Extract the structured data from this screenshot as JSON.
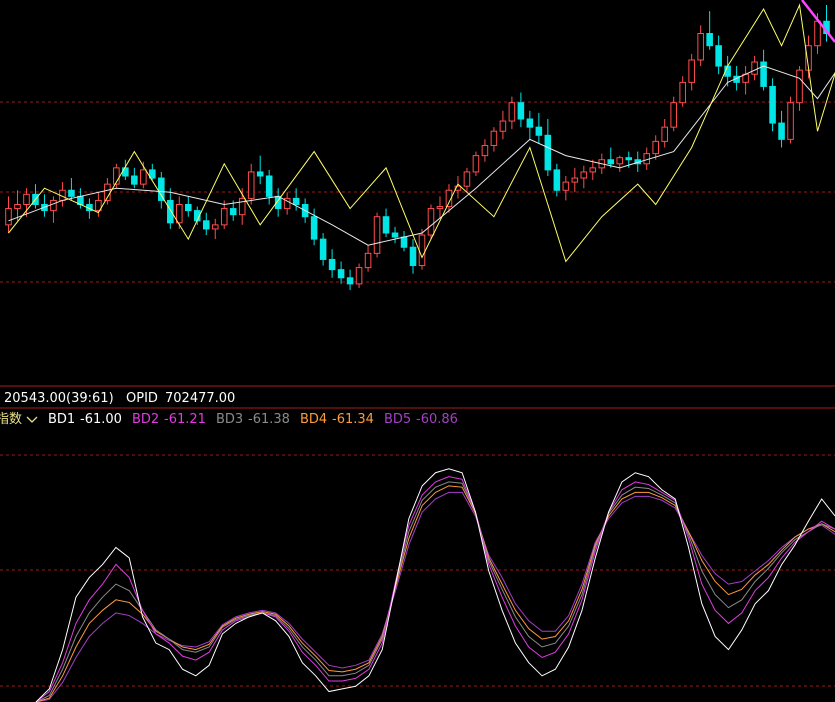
{
  "info_bar": {
    "value": "20543.00(39:61)",
    "opid_label": "OPID",
    "opid_value": "702477.00"
  },
  "indicator": {
    "name": "指数",
    "dropdown_icon": "chevron-down-icon",
    "items": [
      {
        "label": "BD1",
        "value": "-61.00",
        "color": "#ffffff"
      },
      {
        "label": "BD2",
        "value": "-61.21",
        "color": "#e03ce0"
      },
      {
        "label": "BD3",
        "value": "-61.38",
        "color": "#8a8a8a"
      },
      {
        "label": "BD4",
        "value": "-61.34",
        "color": "#ff9a3c"
      },
      {
        "label": "BD5",
        "value": "-60.86",
        "color": "#a53fc8"
      }
    ]
  },
  "colors": {
    "background": "#000000",
    "up_candle": "#ff4d4d",
    "down_candle": "#00e5e5",
    "zigzag": "#ffff66",
    "moving_average": "#e8e8e8",
    "grid": "#9a1a1a",
    "separator": "#a81c1c",
    "name_text": "#e8e08a",
    "trend_line": "#ff44ff"
  },
  "chart_data": [
    {
      "type": "candlestick",
      "title": "",
      "note": "price axis not printed; values in relative price units",
      "ylim": [
        0,
        100
      ],
      "grid": true,
      "candles": [
        {
          "o": 62,
          "h": 76,
          "l": 58,
          "c": 70
        },
        {
          "o": 70,
          "h": 79,
          "l": 64,
          "c": 72
        },
        {
          "o": 72,
          "h": 80,
          "l": 66,
          "c": 77
        },
        {
          "o": 77,
          "h": 82,
          "l": 70,
          "c": 72
        },
        {
          "o": 72,
          "h": 77,
          "l": 66,
          "c": 69
        },
        {
          "o": 69,
          "h": 76,
          "l": 63,
          "c": 74
        },
        {
          "o": 74,
          "h": 83,
          "l": 71,
          "c": 79
        },
        {
          "o": 79,
          "h": 85,
          "l": 74,
          "c": 76
        },
        {
          "o": 76,
          "h": 80,
          "l": 70,
          "c": 72
        },
        {
          "o": 72,
          "h": 75,
          "l": 65,
          "c": 69
        },
        {
          "o": 69,
          "h": 78,
          "l": 66,
          "c": 74
        },
        {
          "o": 74,
          "h": 85,
          "l": 72,
          "c": 82
        },
        {
          "o": 82,
          "h": 92,
          "l": 80,
          "c": 90
        },
        {
          "o": 90,
          "h": 94,
          "l": 84,
          "c": 86
        },
        {
          "o": 86,
          "h": 90,
          "l": 80,
          "c": 82
        },
        {
          "o": 82,
          "h": 93,
          "l": 80,
          "c": 89
        },
        {
          "o": 89,
          "h": 92,
          "l": 84,
          "c": 85
        },
        {
          "o": 85,
          "h": 88,
          "l": 70,
          "c": 74
        },
        {
          "o": 74,
          "h": 80,
          "l": 60,
          "c": 63
        },
        {
          "o": 63,
          "h": 76,
          "l": 60,
          "c": 72
        },
        {
          "o": 72,
          "h": 76,
          "l": 66,
          "c": 69
        },
        {
          "o": 69,
          "h": 71,
          "l": 62,
          "c": 64
        },
        {
          "o": 64,
          "h": 68,
          "l": 57,
          "c": 60
        },
        {
          "o": 60,
          "h": 65,
          "l": 55,
          "c": 62
        },
        {
          "o": 62,
          "h": 74,
          "l": 60,
          "c": 70
        },
        {
          "o": 70,
          "h": 74,
          "l": 64,
          "c": 67
        },
        {
          "o": 67,
          "h": 80,
          "l": 62,
          "c": 75
        },
        {
          "o": 75,
          "h": 92,
          "l": 72,
          "c": 88
        },
        {
          "o": 88,
          "h": 96,
          "l": 82,
          "c": 86
        },
        {
          "o": 86,
          "h": 89,
          "l": 72,
          "c": 76
        },
        {
          "o": 76,
          "h": 80,
          "l": 66,
          "c": 70
        },
        {
          "o": 70,
          "h": 78,
          "l": 67,
          "c": 75
        },
        {
          "o": 75,
          "h": 80,
          "l": 69,
          "c": 72
        },
        {
          "o": 72,
          "h": 75,
          "l": 63,
          "c": 66
        },
        {
          "o": 66,
          "h": 70,
          "l": 52,
          "c": 55
        },
        {
          "o": 55,
          "h": 58,
          "l": 42,
          "c": 45
        },
        {
          "o": 45,
          "h": 50,
          "l": 36,
          "c": 40
        },
        {
          "o": 40,
          "h": 44,
          "l": 33,
          "c": 36
        },
        {
          "o": 36,
          "h": 40,
          "l": 30,
          "c": 33
        },
        {
          "o": 33,
          "h": 43,
          "l": 31,
          "c": 41
        },
        {
          "o": 41,
          "h": 52,
          "l": 39,
          "c": 48
        },
        {
          "o": 48,
          "h": 68,
          "l": 46,
          "c": 66
        },
        {
          "o": 66,
          "h": 70,
          "l": 56,
          "c": 58
        },
        {
          "o": 58,
          "h": 61,
          "l": 53,
          "c": 56
        },
        {
          "o": 56,
          "h": 59,
          "l": 49,
          "c": 51
        },
        {
          "o": 51,
          "h": 55,
          "l": 38,
          "c": 42
        },
        {
          "o": 42,
          "h": 60,
          "l": 40,
          "c": 57
        },
        {
          "o": 57,
          "h": 72,
          "l": 55,
          "c": 70
        },
        {
          "o": 70,
          "h": 76,
          "l": 65,
          "c": 71
        },
        {
          "o": 71,
          "h": 82,
          "l": 68,
          "c": 79
        },
        {
          "o": 79,
          "h": 86,
          "l": 75,
          "c": 81
        },
        {
          "o": 81,
          "h": 90,
          "l": 78,
          "c": 88
        },
        {
          "o": 88,
          "h": 98,
          "l": 86,
          "c": 96
        },
        {
          "o": 96,
          "h": 104,
          "l": 93,
          "c": 101
        },
        {
          "o": 101,
          "h": 110,
          "l": 98,
          "c": 108
        },
        {
          "o": 108,
          "h": 118,
          "l": 104,
          "c": 113
        },
        {
          "o": 113,
          "h": 125,
          "l": 109,
          "c": 122
        },
        {
          "o": 122,
          "h": 127,
          "l": 110,
          "c": 114
        },
        {
          "o": 114,
          "h": 118,
          "l": 104,
          "c": 110
        },
        {
          "o": 110,
          "h": 117,
          "l": 102,
          "c": 106
        },
        {
          "o": 106,
          "h": 114,
          "l": 86,
          "c": 89
        },
        {
          "o": 89,
          "h": 92,
          "l": 76,
          "c": 79
        },
        {
          "o": 79,
          "h": 86,
          "l": 74,
          "c": 83
        },
        {
          "o": 83,
          "h": 90,
          "l": 78,
          "c": 85
        },
        {
          "o": 85,
          "h": 91,
          "l": 80,
          "c": 88
        },
        {
          "o": 88,
          "h": 94,
          "l": 84,
          "c": 90
        },
        {
          "o": 90,
          "h": 97,
          "l": 87,
          "c": 94
        },
        {
          "o": 94,
          "h": 100,
          "l": 90,
          "c": 92
        },
        {
          "o": 92,
          "h": 96,
          "l": 88,
          "c": 95
        },
        {
          "o": 95,
          "h": 98,
          "l": 90,
          "c": 94
        },
        {
          "o": 94,
          "h": 98,
          "l": 88,
          "c": 92
        },
        {
          "o": 92,
          "h": 100,
          "l": 89,
          "c": 97
        },
        {
          "o": 97,
          "h": 106,
          "l": 94,
          "c": 103
        },
        {
          "o": 103,
          "h": 114,
          "l": 100,
          "c": 110
        },
        {
          "o": 110,
          "h": 125,
          "l": 108,
          "c": 122
        },
        {
          "o": 122,
          "h": 135,
          "l": 120,
          "c": 132
        },
        {
          "o": 132,
          "h": 146,
          "l": 128,
          "c": 143
        },
        {
          "o": 143,
          "h": 160,
          "l": 140,
          "c": 156
        },
        {
          "o": 156,
          "h": 167,
          "l": 148,
          "c": 150
        },
        {
          "o": 150,
          "h": 155,
          "l": 136,
          "c": 140
        },
        {
          "o": 140,
          "h": 145,
          "l": 130,
          "c": 135
        },
        {
          "o": 135,
          "h": 140,
          "l": 128,
          "c": 132
        },
        {
          "o": 132,
          "h": 140,
          "l": 126,
          "c": 136
        },
        {
          "o": 136,
          "h": 145,
          "l": 133,
          "c": 142
        },
        {
          "o": 142,
          "h": 148,
          "l": 128,
          "c": 130
        },
        {
          "o": 130,
          "h": 134,
          "l": 108,
          "c": 112
        },
        {
          "o": 112,
          "h": 118,
          "l": 100,
          "c": 104
        },
        {
          "o": 104,
          "h": 125,
          "l": 102,
          "c": 122
        },
        {
          "o": 122,
          "h": 140,
          "l": 118,
          "c": 138
        },
        {
          "o": 138,
          "h": 155,
          "l": 134,
          "c": 150
        },
        {
          "o": 150,
          "h": 166,
          "l": 146,
          "c": 162
        },
        {
          "o": 162,
          "h": 170,
          "l": 152,
          "c": 156
        }
      ],
      "zigzag": [
        [
          0,
          58
        ],
        [
          4,
          80
        ],
        [
          10,
          68
        ],
        [
          14,
          98
        ],
        [
          20,
          55
        ],
        [
          24,
          92
        ],
        [
          28,
          62
        ],
        [
          34,
          98
        ],
        [
          38,
          70
        ],
        [
          42,
          90
        ],
        [
          46,
          46
        ],
        [
          50,
          82
        ],
        [
          54,
          66
        ],
        [
          58,
          100
        ],
        [
          62,
          44
        ],
        [
          66,
          66
        ],
        [
          70,
          82
        ],
        [
          72,
          72
        ],
        [
          76,
          100
        ],
        [
          80,
          140
        ],
        [
          84,
          168
        ],
        [
          86,
          150
        ],
        [
          88,
          170
        ],
        [
          90,
          108
        ],
        [
          94,
          166
        ]
      ],
      "moving_average": [
        [
          0,
          64
        ],
        [
          6,
          74
        ],
        [
          12,
          80
        ],
        [
          18,
          78
        ],
        [
          24,
          72
        ],
        [
          30,
          76
        ],
        [
          36,
          62
        ],
        [
          40,
          52
        ],
        [
          46,
          58
        ],
        [
          52,
          80
        ],
        [
          58,
          104
        ],
        [
          62,
          96
        ],
        [
          68,
          90
        ],
        [
          74,
          98
        ],
        [
          80,
          132
        ],
        [
          84,
          140
        ],
        [
          88,
          134
        ],
        [
          90,
          124
        ],
        [
          94,
          150
        ]
      ]
    },
    {
      "type": "line",
      "title": "",
      "ylim": [
        -100,
        100
      ],
      "grid": true,
      "x_count": 61,
      "series": [
        {
          "name": "BD1",
          "color": "#ffffff",
          "values": [
            -100,
            -90,
            -60,
            -20,
            -5,
            5,
            18,
            10,
            -35,
            -55,
            -60,
            -75,
            -80,
            -72,
            -48,
            -40,
            -35,
            -32,
            -38,
            -50,
            -70,
            -80,
            -92,
            -90,
            -88,
            -80,
            -60,
            -10,
            40,
            65,
            75,
            78,
            75,
            45,
            0,
            -30,
            -55,
            -70,
            -80,
            -75,
            -58,
            -30,
            10,
            45,
            68,
            75,
            72,
            62,
            55,
            18,
            -25,
            -50,
            -60,
            -45,
            -25,
            -15,
            5,
            20,
            38,
            55,
            42
          ]
        },
        {
          "name": "BD2",
          "color": "#e03ce0",
          "values": [
            -100,
            -92,
            -70,
            -40,
            -22,
            -10,
            5,
            -5,
            -30,
            -48,
            -55,
            -65,
            -68,
            -62,
            -45,
            -38,
            -35,
            -32,
            -35,
            -46,
            -62,
            -72,
            -84,
            -84,
            -82,
            -75,
            -55,
            -8,
            35,
            58,
            68,
            72,
            70,
            45,
            5,
            -20,
            -42,
            -58,
            -66,
            -62,
            -48,
            -22,
            15,
            45,
            62,
            68,
            66,
            60,
            54,
            25,
            -10,
            -30,
            -40,
            -32,
            -15,
            -5,
            10,
            22,
            30,
            38,
            32
          ]
        },
        {
          "name": "BD3",
          "color": "#8a8a8a",
          "values": [
            -100,
            -95,
            -75,
            -50,
            -32,
            -20,
            -10,
            -15,
            -30,
            -45,
            -52,
            -60,
            -62,
            -58,
            -43,
            -37,
            -34,
            -32,
            -34,
            -44,
            -58,
            -68,
            -80,
            -80,
            -78,
            -72,
            -52,
            -10,
            30,
            54,
            64,
            68,
            67,
            45,
            8,
            -14,
            -35,
            -50,
            -58,
            -55,
            -42,
            -18,
            18,
            44,
            58,
            64,
            63,
            58,
            52,
            28,
            0,
            -18,
            -28,
            -22,
            -8,
            2,
            14,
            24,
            30,
            36,
            32
          ]
        },
        {
          "name": "BD4",
          "color": "#ff9a3c",
          "values": [
            -100,
            -97,
            -80,
            -58,
            -40,
            -30,
            -22,
            -24,
            -33,
            -46,
            -52,
            -58,
            -60,
            -56,
            -42,
            -36,
            -33,
            -31,
            -33,
            -42,
            -55,
            -65,
            -76,
            -77,
            -75,
            -70,
            -50,
            -12,
            25,
            50,
            60,
            65,
            64,
            44,
            10,
            -10,
            -30,
            -44,
            -52,
            -50,
            -38,
            -14,
            20,
            42,
            55,
            60,
            60,
            56,
            50,
            30,
            8,
            -8,
            -18,
            -14,
            -3,
            5,
            16,
            26,
            32,
            36,
            30
          ]
        },
        {
          "name": "BD5",
          "color": "#a53fc8",
          "values": [
            -100,
            -98,
            -85,
            -66,
            -50,
            -40,
            -32,
            -34,
            -40,
            -48,
            -53,
            -57,
            -58,
            -54,
            -41,
            -35,
            -32,
            -30,
            -32,
            -40,
            -52,
            -62,
            -72,
            -74,
            -72,
            -68,
            -48,
            -15,
            20,
            45,
            55,
            60,
            60,
            42,
            12,
            -5,
            -25,
            -38,
            -46,
            -46,
            -34,
            -10,
            22,
            40,
            52,
            57,
            57,
            54,
            48,
            30,
            12,
            -2,
            -10,
            -8,
            0,
            8,
            18,
            26,
            32,
            35,
            28
          ]
        }
      ]
    }
  ]
}
